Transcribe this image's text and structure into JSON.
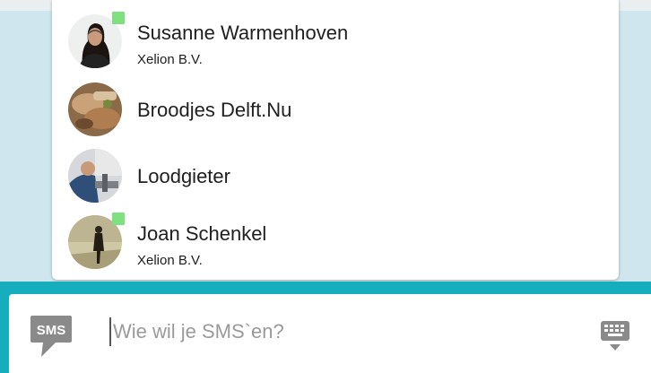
{
  "contacts": [
    {
      "name": "Susanne Warmenhoven",
      "company": "Xelion B.V.",
      "online": true,
      "avatar": "woman-with-headset-photo"
    },
    {
      "name": "Broodjes Delft.Nu",
      "company": "",
      "online": false,
      "avatar": "sandwich-photo"
    },
    {
      "name": "Loodgieter",
      "company": "",
      "online": false,
      "avatar": "plumber-photo"
    },
    {
      "name": "Joan Schenkel",
      "company": "Xelion B.V.",
      "online": true,
      "avatar": "person-walking-photo"
    }
  ],
  "compose": {
    "icon_label": "SMS",
    "placeholder": "Wie wil je SMS`en?",
    "value": ""
  },
  "icons": {
    "compose": "sms-bubble-icon",
    "keyboard": "keyboard-icon"
  },
  "colors": {
    "background": "#cfe6ef",
    "compose_bar": "#16aebd",
    "presence_online": "#7ee07e",
    "sms_icon": "#8a8a8a"
  }
}
